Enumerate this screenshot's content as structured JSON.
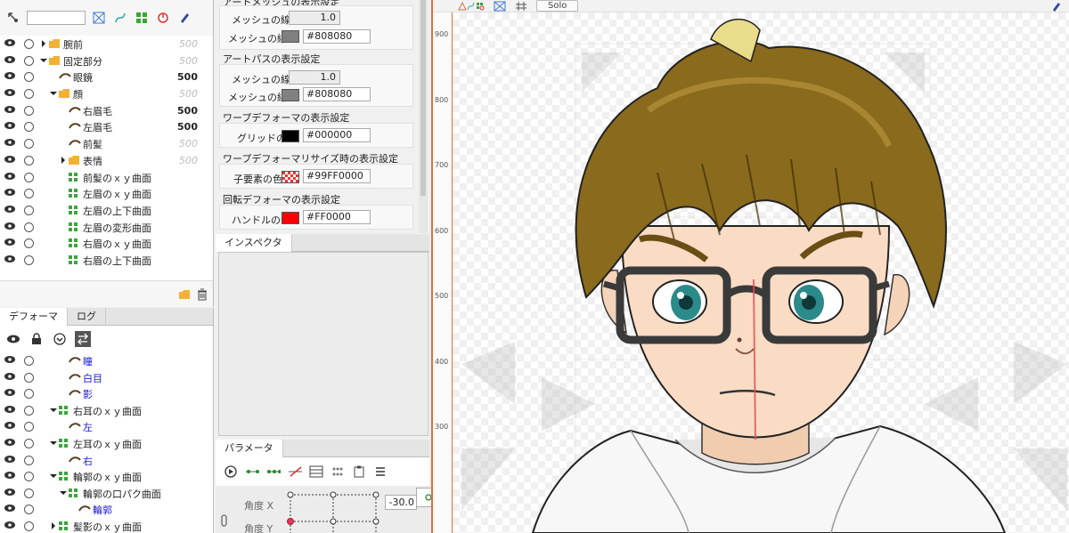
{
  "layers": {
    "rows": [
      {
        "name": "腕前",
        "value": "500",
        "dim": true,
        "indent": 1,
        "type": "folder",
        "arrow": "right"
      },
      {
        "name": "固定部分",
        "value": "500",
        "dim": true,
        "indent": 1,
        "type": "folder",
        "arrow": "down"
      },
      {
        "name": "眼鏡",
        "value": "500",
        "dim": false,
        "indent": 2,
        "type": "art"
      },
      {
        "name": "顔",
        "value": "500",
        "dim": true,
        "indent": 2,
        "type": "folder",
        "arrow": "down"
      },
      {
        "name": "右眉毛",
        "value": "500",
        "dim": false,
        "indent": 3,
        "type": "art"
      },
      {
        "name": "左眉毛",
        "value": "500",
        "dim": false,
        "indent": 3,
        "type": "art"
      },
      {
        "name": "前髪",
        "value": "500",
        "dim": true,
        "indent": 3,
        "type": "art"
      },
      {
        "name": "表情",
        "value": "500",
        "dim": true,
        "indent": 3,
        "type": "folder",
        "arrow": "right"
      },
      {
        "name": "前髪のｘｙ曲面",
        "value": "",
        "dim": false,
        "indent": 3,
        "type": "warp"
      },
      {
        "name": "左眉のｘｙ曲面",
        "value": "",
        "dim": false,
        "indent": 3,
        "type": "warp"
      },
      {
        "name": "左眉の上下曲面",
        "value": "",
        "dim": false,
        "indent": 3,
        "type": "warp"
      },
      {
        "name": "左眉の変形曲面",
        "value": "",
        "dim": false,
        "indent": 3,
        "type": "warp"
      },
      {
        "name": "右眉のｘｙ曲面",
        "value": "",
        "dim": false,
        "indent": 3,
        "type": "warp"
      },
      {
        "name": "右眉の上下曲面",
        "value": "",
        "dim": false,
        "indent": 3,
        "type": "warp"
      }
    ]
  },
  "deformer": {
    "tabs": [
      {
        "label": "デフォーマ",
        "active": true
      },
      {
        "label": "ログ",
        "active": false
      }
    ],
    "rows": [
      {
        "name": "瞳",
        "indent": 3,
        "type": "art",
        "blue": true,
        "arrow": ""
      },
      {
        "name": "白目",
        "indent": 3,
        "type": "art",
        "blue": true,
        "arrow": ""
      },
      {
        "name": "影",
        "indent": 3,
        "type": "art",
        "blue": true,
        "arrow": ""
      },
      {
        "name": "右耳のｘｙ曲面",
        "indent": 2,
        "type": "warp",
        "blue": false,
        "arrow": "down"
      },
      {
        "name": "左",
        "indent": 3,
        "type": "art",
        "blue": true,
        "arrow": ""
      },
      {
        "name": "左耳のｘｙ曲面",
        "indent": 2,
        "type": "warp",
        "blue": false,
        "arrow": "down"
      },
      {
        "name": "右",
        "indent": 3,
        "type": "art",
        "blue": true,
        "arrow": ""
      },
      {
        "name": "輪郭のｘｙ曲面",
        "indent": 2,
        "type": "warp",
        "blue": false,
        "arrow": "down"
      },
      {
        "name": "輪郭の口パク曲面",
        "indent": 3,
        "type": "warp",
        "blue": false,
        "arrow": "down"
      },
      {
        "name": "輪郭",
        "indent": 4,
        "type": "art",
        "blue": true,
        "arrow": ""
      },
      {
        "name": "髪影のｘｙ曲面",
        "indent": 2,
        "type": "warp",
        "blue": false,
        "arrow": "right"
      }
    ]
  },
  "settings": {
    "mesh_group_title": "アートメッシュの表示設定",
    "mesh_width_label": "メッシュの線幅",
    "mesh_width_value": "1.0",
    "mesh_color_label": "メッシュの線色",
    "mesh_color_value": "#808080",
    "artpath_title": "アートパスの表示設定",
    "artpath_width_label": "メッシュの線幅",
    "artpath_width_value": "1.0",
    "artpath_color_label": "メッシュの線色",
    "artpath_color_value": "#808080",
    "warp_title": "ワープデフォーマの表示設定",
    "grid_color_label": "グリッドの色",
    "grid_color_value": "#000000",
    "warp_resize_title": "ワープデフォーマリサイズ時の表示設定",
    "child_color_label": "子要素の色",
    "child_color_value": "#99FF0000",
    "rotation_title": "回転デフォーマの表示設定",
    "handle_color_label": "ハンドルの色",
    "handle_color_value": "#FF0000"
  },
  "inspector": {
    "tab_label": "インスペクタ"
  },
  "params": {
    "tab_label": "パラメータ",
    "angle_x_label": "角度 X",
    "angle_x_value": "-30.0",
    "angle_y_label": "角度 Y"
  },
  "canvas": {
    "solo_label": "Solo",
    "ruler_ticks": [
      "900",
      "800",
      "700",
      "600",
      "500",
      "400",
      "300"
    ]
  },
  "colors": {
    "accent": "#e76b3c",
    "mesh_swatch": "#808080",
    "grid_swatch": "#000000",
    "handle_swatch": "#FF0000"
  }
}
